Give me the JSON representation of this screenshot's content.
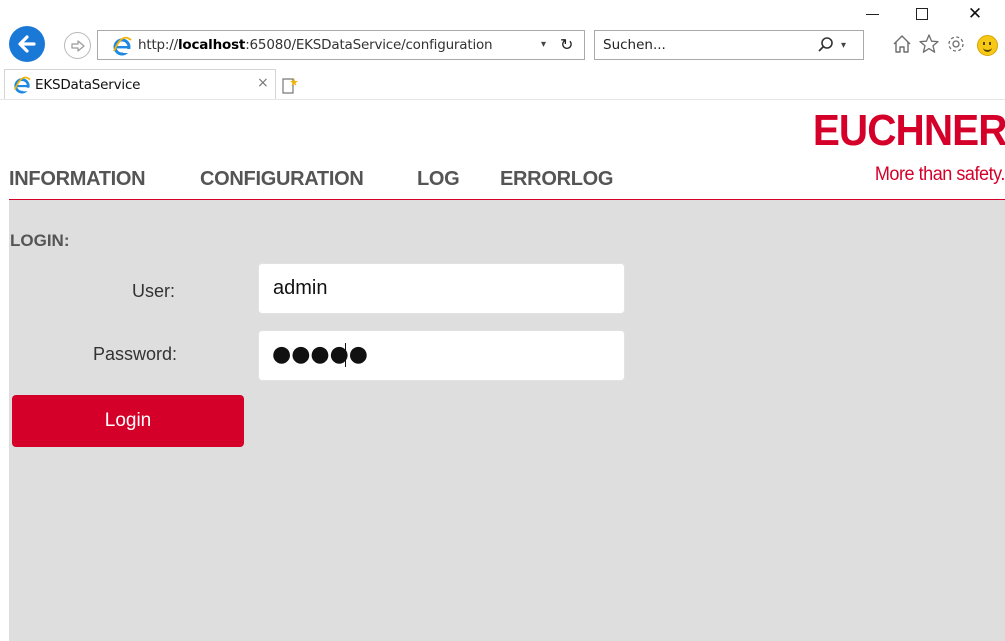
{
  "browser": {
    "url_prefix": "http://",
    "url_host": "localhost",
    "url_rest": ":65080/EKSDataService/configuration",
    "search_placeholder": "Suchen...",
    "tab_title": "EKSDataService",
    "tab_close": "×",
    "dropdown_glyph": "▾",
    "refresh_glyph": "↻"
  },
  "window_controls": {
    "close_glyph": "✕"
  },
  "toolbar_icons": [
    "home-icon",
    "favorites-star-icon",
    "settings-gear-icon",
    "smiley-feedback-icon"
  ],
  "branding": {
    "logo": "EUCHNER",
    "tagline": "More than safety.",
    "brand_color": "#d5002a"
  },
  "nav": {
    "items": [
      {
        "label": "INFORMATION"
      },
      {
        "label": "CONFIGURATION"
      },
      {
        "label": "LOG"
      },
      {
        "label": "ERRORLOG"
      }
    ]
  },
  "login": {
    "heading": "LOGIN:",
    "user_label": "User:",
    "user_value": "admin",
    "password_label": "Password:",
    "password_masked": "●●●●●",
    "button_label": "Login"
  },
  "colors": {
    "content_background": "#dedede",
    "nav_text": "#555555",
    "browser_back_button": "#1a78d6"
  }
}
